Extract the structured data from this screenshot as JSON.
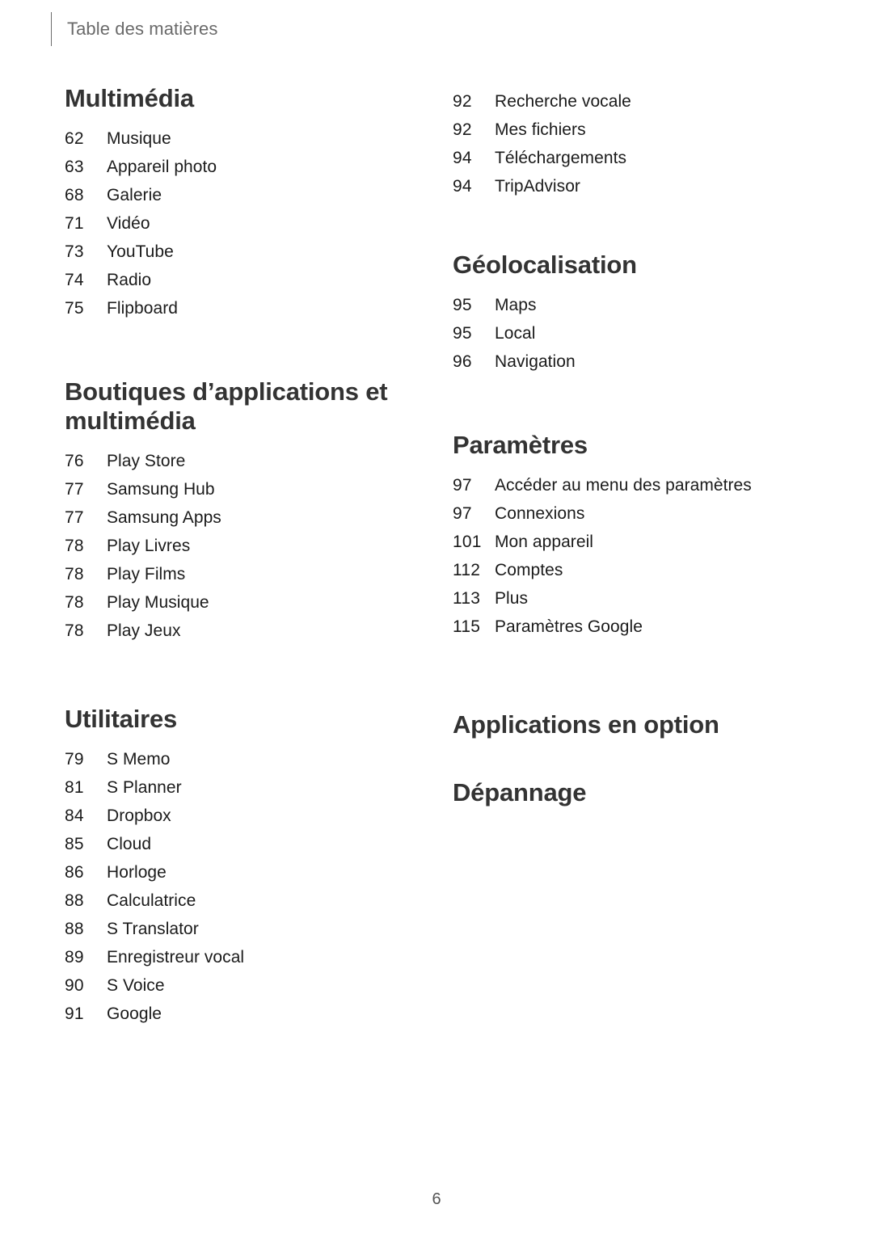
{
  "header": {
    "title": "Table des matières"
  },
  "folio": {
    "page_number": "6"
  },
  "colors": {
    "heading": "#333333",
    "entry_text": "#1b1b1b",
    "header_text": "#6a6a6a",
    "rule": "#6d6d6d",
    "background": "#ffffff"
  },
  "left_column": {
    "sections": [
      {
        "heading": "Multimédia",
        "entries": [
          {
            "page": "62",
            "label": "Musique"
          },
          {
            "page": "63",
            "label": "Appareil photo"
          },
          {
            "page": "68",
            "label": "Galerie"
          },
          {
            "page": "71",
            "label": "Vidéo"
          },
          {
            "page": "73",
            "label": "YouTube"
          },
          {
            "page": "74",
            "label": "Radio"
          },
          {
            "page": "75",
            "label": "Flipboard"
          }
        ]
      },
      {
        "heading": "Boutiques d’applications et multimédia",
        "entries": [
          {
            "page": "76",
            "label": "Play Store"
          },
          {
            "page": "77",
            "label": "Samsung Hub"
          },
          {
            "page": "77",
            "label": "Samsung Apps"
          },
          {
            "page": "78",
            "label": "Play Livres"
          },
          {
            "page": "78",
            "label": "Play Films"
          },
          {
            "page": "78",
            "label": "Play Musique"
          },
          {
            "page": "78",
            "label": "Play Jeux"
          }
        ]
      },
      {
        "heading": "Utilitaires",
        "entries": [
          {
            "page": "79",
            "label": "S Memo"
          },
          {
            "page": "81",
            "label": "S Planner"
          },
          {
            "page": "84",
            "label": "Dropbox"
          },
          {
            "page": "85",
            "label": "Cloud"
          },
          {
            "page": "86",
            "label": "Horloge"
          },
          {
            "page": "88",
            "label": "Calculatrice"
          },
          {
            "page": "88",
            "label": "S Translator"
          },
          {
            "page": "89",
            "label": "Enregistreur vocal"
          },
          {
            "page": "90",
            "label": "S Voice"
          },
          {
            "page": "91",
            "label": "Google"
          }
        ]
      }
    ]
  },
  "right_column": {
    "continued_entries": [
      {
        "page": "92",
        "label": "Recherche vocale"
      },
      {
        "page": "92",
        "label": "Mes fichiers"
      },
      {
        "page": "94",
        "label": "Téléchargements"
      },
      {
        "page": "94",
        "label": "TripAdvisor"
      }
    ],
    "sections": [
      {
        "heading": "Géolocalisation",
        "entries": [
          {
            "page": "95",
            "label": "Maps"
          },
          {
            "page": "95",
            "label": "Local"
          },
          {
            "page": "96",
            "label": "Navigation"
          }
        ]
      },
      {
        "heading": "Paramètres",
        "entries": [
          {
            "page": "97",
            "label": "Accéder au menu des paramètres"
          },
          {
            "page": "97",
            "label": "Connexions"
          },
          {
            "page": "101",
            "label": "Mon appareil"
          },
          {
            "page": "112",
            "label": "Comptes"
          },
          {
            "page": "113",
            "label": "Plus"
          },
          {
            "page": "115",
            "label": "Paramètres Google"
          }
        ]
      },
      {
        "heading": "Applications en option",
        "entries": []
      },
      {
        "heading": "Dépannage",
        "entries": []
      }
    ]
  }
}
